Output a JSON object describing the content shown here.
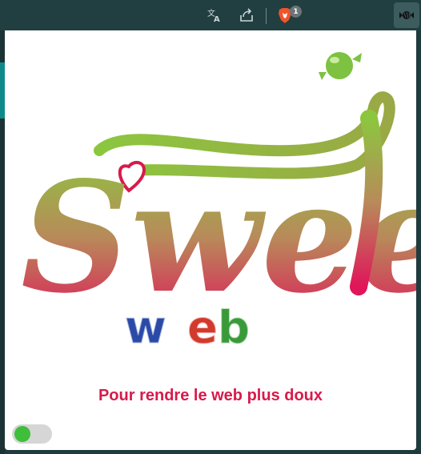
{
  "toolbar": {
    "translate_icon": "translate-icon",
    "share_icon": "share-icon",
    "brave_icon": "brave-shields-icon",
    "brave_badge_count": "1",
    "extension_icon": "candy-extension-icon"
  },
  "popup": {
    "logo_main_text": "Sweet",
    "logo_sub_text": "web",
    "tagline": "Pour rendre le web plus doux",
    "toggle_state": "on"
  },
  "colors": {
    "tagline": "#d81a4a",
    "toggle_on": "#3fbe3c",
    "gradient_top": "#8cc63f",
    "gradient_bottom": "#e0155a"
  }
}
